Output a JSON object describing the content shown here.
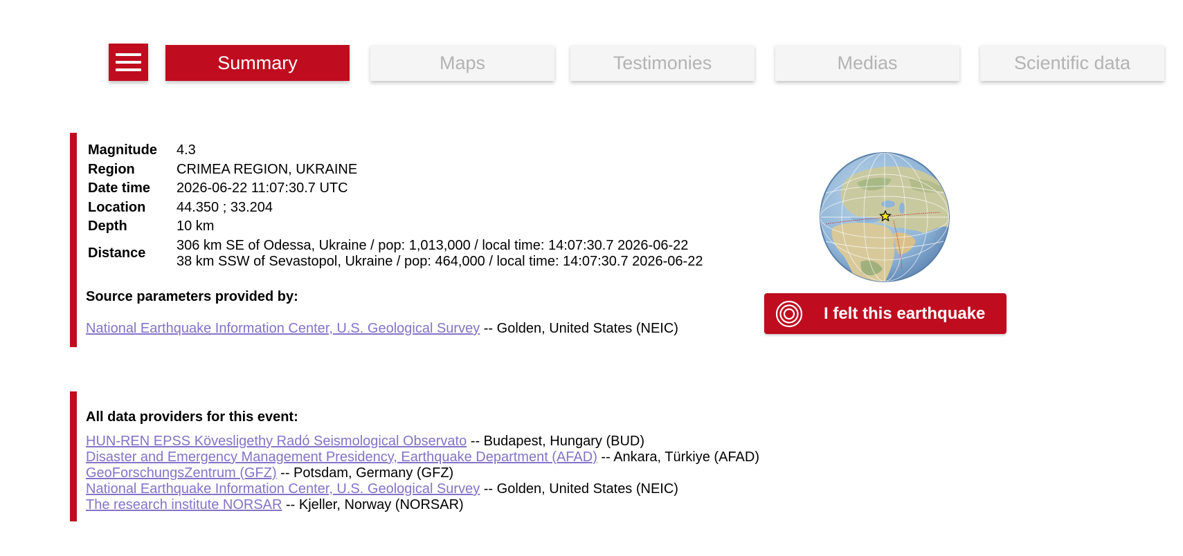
{
  "nav": {
    "menu_icon": "hamburger-icon",
    "tabs": [
      {
        "label": "Summary",
        "active": true
      },
      {
        "label": "Maps",
        "active": false
      },
      {
        "label": "Testimonies",
        "active": false
      },
      {
        "label": "Medias",
        "active": false
      },
      {
        "label": "Scientific data",
        "active": false
      }
    ]
  },
  "event": {
    "rows": [
      {
        "label": "Magnitude",
        "value": "4.3"
      },
      {
        "label": "Region",
        "value": "CRIMEA REGION, UKRAINE"
      },
      {
        "label": "Date time",
        "value": "2026-06-22 11:07:30.7 UTC"
      },
      {
        "label": "Location",
        "value": "44.350 ; 33.204"
      },
      {
        "label": "Depth",
        "value": "10 km"
      }
    ],
    "distance": {
      "label": "Distance",
      "lines": [
        "306 km SE of Odessa, Ukraine / pop: 1,013,000 / local time: 14:07:30.7 2026-06-22",
        "38 km SSW of Sevastopol, Ukraine / pop: 464,000 / local time: 14:07:30.7 2026-06-22"
      ]
    }
  },
  "source": {
    "title": "Source parameters provided by:",
    "provider": {
      "name": "National Earthquake Information Center, U.S. Geological Survey",
      "suffix": " -- Golden, United States (NEIC)"
    }
  },
  "providers": {
    "title": "All data providers for this event:",
    "items": [
      {
        "name": "HUN-REN EPSS Kövesligethy Radó Seismological Observato",
        "suffix": " -- Budapest, Hungary (BUD)"
      },
      {
        "name": "Disaster and Emergency Management Presidency, Earthquake Department (AFAD)",
        "suffix": " -- Ankara, Türkiye (AFAD)"
      },
      {
        "name": "GeoForschungsZentrum (GFZ)",
        "suffix": " -- Potsdam, Germany (GFZ)"
      },
      {
        "name": "National Earthquake Information Center, U.S. Geological Survey",
        "suffix": " -- Golden, United States (NEIC)"
      },
      {
        "name": "The research institute NORSAR",
        "suffix": " -- Kjeller, Norway (NORSAR)"
      }
    ]
  },
  "globe": {
    "icon": "globe-epicenter-map",
    "marker": "star-icon"
  },
  "felt_button": {
    "label": "I felt this earthquake",
    "icon": "concentric-circles-icon"
  },
  "colors": {
    "accent": "#bf0c1f",
    "link": "#8473c8",
    "inactive_tab_bg": "#f5f5f5",
    "inactive_tab_text": "#b3b3b3"
  }
}
